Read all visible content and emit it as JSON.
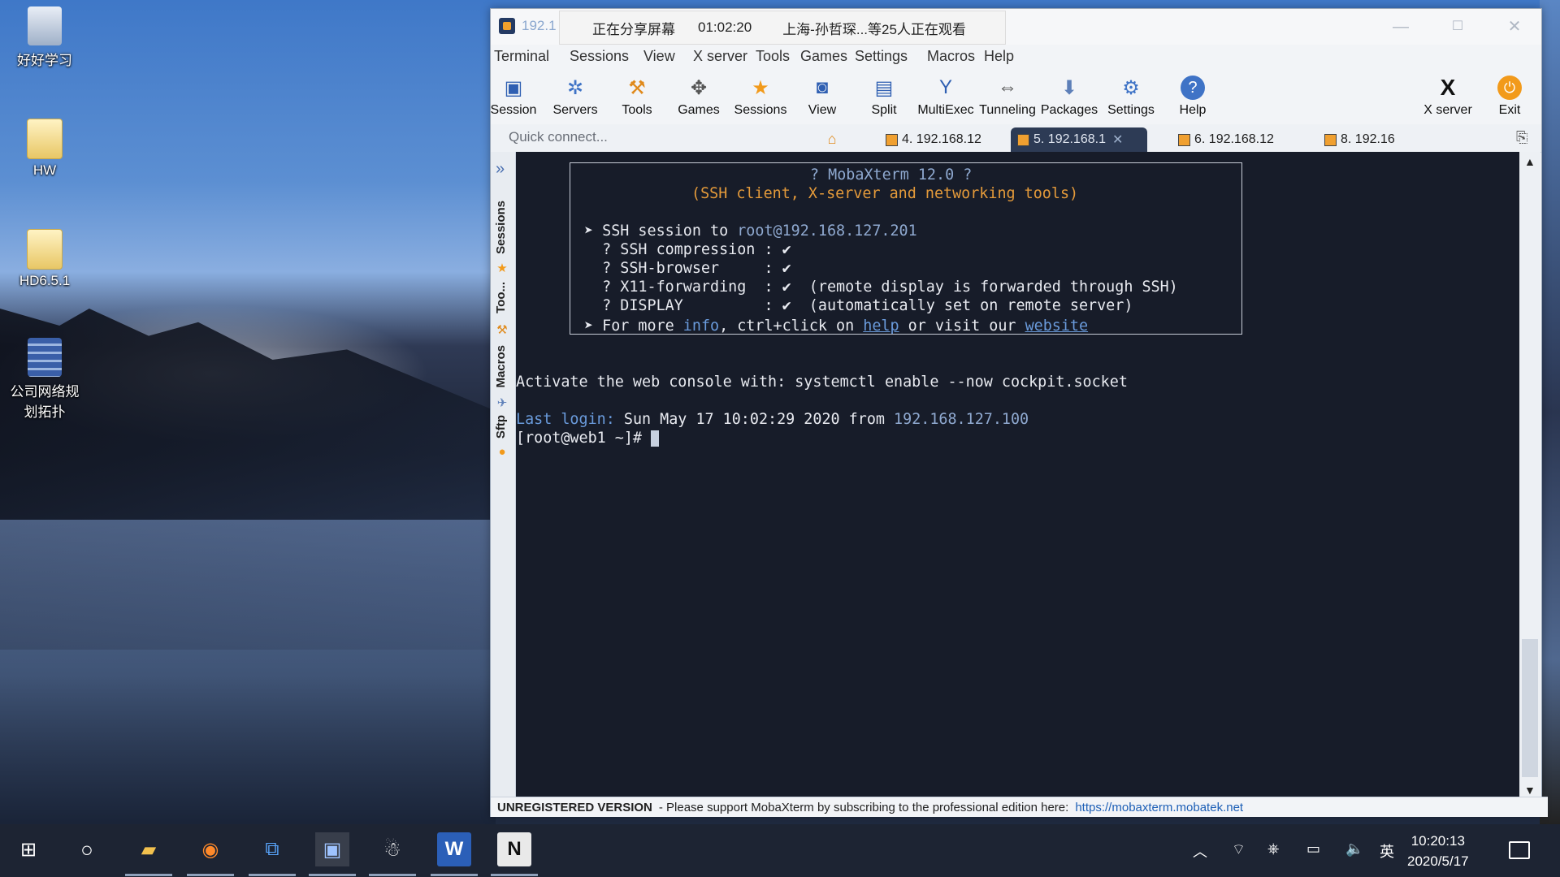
{
  "desktop": {
    "icons": [
      {
        "label": "好好学习",
        "icon": "recycle-bin-icon"
      },
      {
        "label": "HW",
        "icon": "folder-icon"
      },
      {
        "label": "HD6.5.1",
        "icon": "folder-icon"
      },
      {
        "label": "公司网络规划拓扑",
        "icon": "archive-icon"
      }
    ]
  },
  "window": {
    "title_fragment": "192.1",
    "share_banner": {
      "status": "正在分享屏幕",
      "duration": "01:02:20",
      "viewers": "上海-孙哲琛...等25人正在观看"
    },
    "controls": {
      "minimize": "—",
      "maximize": "☐",
      "close": "✕"
    }
  },
  "menu": [
    "Terminal",
    "Sessions",
    "View",
    "X server",
    "Tools",
    "Games",
    "Settings",
    "Macros",
    "Help"
  ],
  "toolbar": [
    {
      "label": "Session",
      "icon": "monitor-icon"
    },
    {
      "label": "Servers",
      "icon": "servers-icon"
    },
    {
      "label": "Tools",
      "icon": "tools-icon"
    },
    {
      "label": "Games",
      "icon": "gamepad-icon"
    },
    {
      "label": "Sessions",
      "icon": "star-icon"
    },
    {
      "label": "View",
      "icon": "view-icon"
    },
    {
      "label": "Split",
      "icon": "split-icon"
    },
    {
      "label": "MultiExec",
      "icon": "multiexec-icon"
    },
    {
      "label": "Tunneling",
      "icon": "tunneling-icon"
    },
    {
      "label": "Packages",
      "icon": "packages-icon"
    },
    {
      "label": "Settings",
      "icon": "settings-icon"
    },
    {
      "label": "Help",
      "icon": "help-icon"
    },
    {
      "label": "X server",
      "icon": "x-server-icon"
    },
    {
      "label": "Exit",
      "icon": "power-icon"
    }
  ],
  "quick_connect_placeholder": "Quick connect...",
  "tabs": [
    {
      "label": "4. 192.168.12",
      "active": false
    },
    {
      "label": "5. 192.168.1",
      "active": true
    },
    {
      "label": "6. 192.168.12",
      "active": false
    },
    {
      "label": "8. 192.16",
      "active": false
    }
  ],
  "sidebar": [
    "Sessions",
    "Too...",
    "Macros",
    "Sftp"
  ],
  "terminal": {
    "banner_title": "? MobaXterm 12.0 ?",
    "banner_subtitle": "(SSH client, X-server and networking tools)",
    "ssh_to_prefix": "➤ SSH session to ",
    "ssh_target": "root@192.168.127.201",
    "lines": [
      "  ? SSH compression : ✔",
      "  ? SSH-browser     : ✔",
      "  ? X11-forwarding  : ✔  (remote display is forwarded through SSH)",
      "  ? DISPLAY         : ✔  (automatically set on remote server)"
    ],
    "more_prefix": "➤ For more ",
    "info": "info",
    "ctrl_text": ", ctrl+click on ",
    "help": "help",
    "visit_text": " or visit our ",
    "website": "website",
    "activate": "Activate the web console with: systemctl enable --now cockpit.socket",
    "last_login_label": "Last login:",
    "last_login_value": " Sun May 17 10:02:29 2020 from ",
    "last_login_ip": "192.168.127.100",
    "prompt": "[root@web1 ~]# "
  },
  "status": {
    "bold": "UNREGISTERED VERSION",
    "text": "-  Please support MobaXterm by subscribing to the professional edition here:",
    "link": "https://mobaxterm.mobatek.net"
  },
  "taskbar": {
    "apps": [
      "start-icon",
      "search-circle-icon",
      "file-explorer-icon",
      "firefox-icon",
      "remote-desktop-icon",
      "mobaxterm-icon",
      "qq-icon",
      "word-icon",
      "onenote-icon"
    ],
    "tray_lang": "英",
    "time": "10:20:13",
    "date": "2020/5/17"
  }
}
